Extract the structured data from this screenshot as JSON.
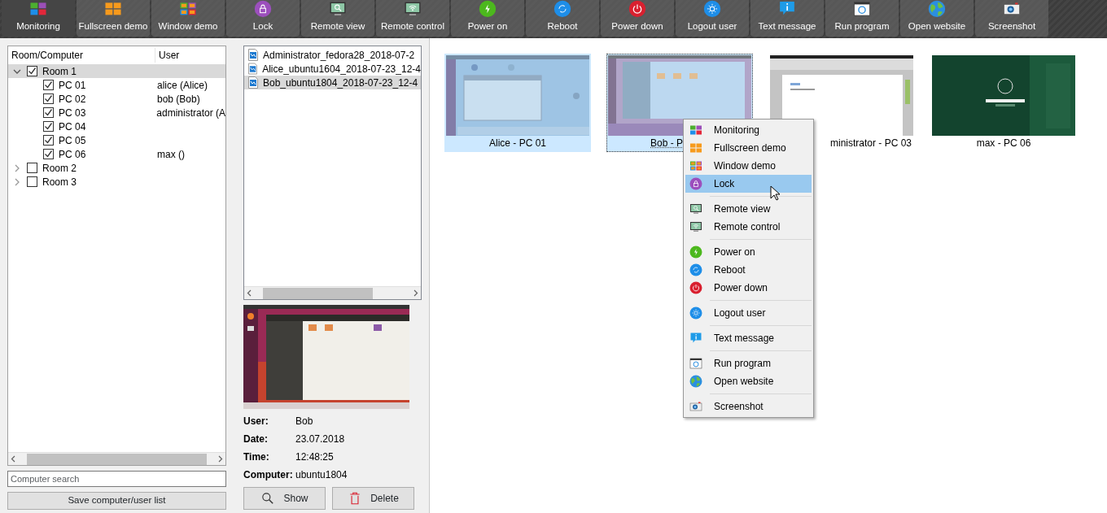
{
  "toolbar": [
    {
      "label": "Monitoring",
      "kind": "monitoring",
      "selected": true
    },
    {
      "label": "Fullscreen demo",
      "kind": "fullscreen",
      "selected": false
    },
    {
      "label": "Window demo",
      "kind": "window",
      "selected": false
    },
    {
      "label": "Lock",
      "kind": "lock",
      "selected": false
    },
    {
      "label": "Remote view",
      "kind": "remoteview",
      "selected": false
    },
    {
      "label": "Remote control",
      "kind": "remotecontrol",
      "selected": false
    },
    {
      "label": "Power on",
      "kind": "poweron",
      "selected": false
    },
    {
      "label": "Reboot",
      "kind": "reboot",
      "selected": false
    },
    {
      "label": "Power down",
      "kind": "powerdown",
      "selected": false
    },
    {
      "label": "Logout user",
      "kind": "logout",
      "selected": false
    },
    {
      "label": "Text message",
      "kind": "message",
      "selected": false
    },
    {
      "label": "Run program",
      "kind": "run",
      "selected": false
    },
    {
      "label": "Open website",
      "kind": "website",
      "selected": false
    },
    {
      "label": "Screenshot",
      "kind": "screenshot",
      "selected": false
    }
  ],
  "computer_tree": {
    "columns": [
      "Room/Computer",
      "User"
    ],
    "rows": [
      {
        "label": "Room 1",
        "checked": true,
        "expanded": true,
        "selected": true,
        "children": [
          {
            "label": "PC 01",
            "user": "alice (Alice)",
            "checked": true
          },
          {
            "label": "PC 02",
            "user": "bob (Bob)",
            "checked": true
          },
          {
            "label": "PC 03",
            "user": "administrator (A",
            "checked": true
          },
          {
            "label": "PC 04",
            "checked": true
          },
          {
            "label": "PC 05",
            "checked": true
          },
          {
            "label": "PC 06",
            "user": "max ()",
            "checked": true
          }
        ]
      },
      {
        "label": "Room 2",
        "checked": false,
        "expanded": false,
        "selected": false
      },
      {
        "label": "Room 3",
        "checked": false,
        "expanded": false,
        "selected": false
      }
    ]
  },
  "search": {
    "placeholder": "Computer search"
  },
  "save_button": "Save computer/user list",
  "screenshot_files": [
    {
      "name": "Administrator_fedora28_2018-07-2",
      "selected": false
    },
    {
      "name": "Alice_ubuntu1604_2018-07-23_12-4",
      "selected": false
    },
    {
      "name": "Bob_ubuntu1804_2018-07-23_12-4",
      "selected": true
    }
  ],
  "screenshot_info": [
    {
      "label": "User:",
      "value": "Bob"
    },
    {
      "label": "Date:",
      "value": "23.07.2018"
    },
    {
      "label": "Time:",
      "value": "12:48:25"
    },
    {
      "label": "Computer:",
      "value": "ubuntu1804"
    }
  ],
  "screenshot_buttons": [
    {
      "label": "Show",
      "kind": "show"
    },
    {
      "label": "Delete",
      "kind": "delete"
    }
  ],
  "computers": [
    {
      "label": "Alice - PC 01",
      "selected": true,
      "focused": false
    },
    {
      "label": "Bob - P",
      "selected": true,
      "focused": true
    },
    {
      "label": "ministrator - PC 03",
      "selected": false,
      "focused": false
    },
    {
      "label": "max - PC 06",
      "selected": false,
      "focused": false
    }
  ],
  "context_menu": {
    "groups": [
      [
        {
          "label": "Monitoring",
          "kind": "monitoring",
          "selected": false
        },
        {
          "label": "Fullscreen demo",
          "kind": "fullscreen",
          "selected": false
        },
        {
          "label": "Window demo",
          "kind": "window",
          "selected": false
        },
        {
          "label": "Lock",
          "kind": "lock",
          "selected": true
        }
      ],
      [
        {
          "label": "Remote view",
          "kind": "remoteview",
          "selected": false
        },
        {
          "label": "Remote control",
          "kind": "remotecontrol",
          "selected": false
        }
      ],
      [
        {
          "label": "Power on",
          "kind": "poweron",
          "selected": false
        },
        {
          "label": "Reboot",
          "kind": "reboot",
          "selected": false
        },
        {
          "label": "Power down",
          "kind": "powerdown",
          "selected": false
        }
      ],
      [
        {
          "label": "Logout user",
          "kind": "logout",
          "selected": false
        }
      ],
      [
        {
          "label": "Text message",
          "kind": "message",
          "selected": false
        }
      ],
      [
        {
          "label": "Run program",
          "kind": "run",
          "selected": false
        },
        {
          "label": "Open website",
          "kind": "website",
          "selected": false
        }
      ],
      [
        {
          "label": "Screenshot",
          "kind": "screenshot",
          "selected": false
        }
      ]
    ]
  }
}
